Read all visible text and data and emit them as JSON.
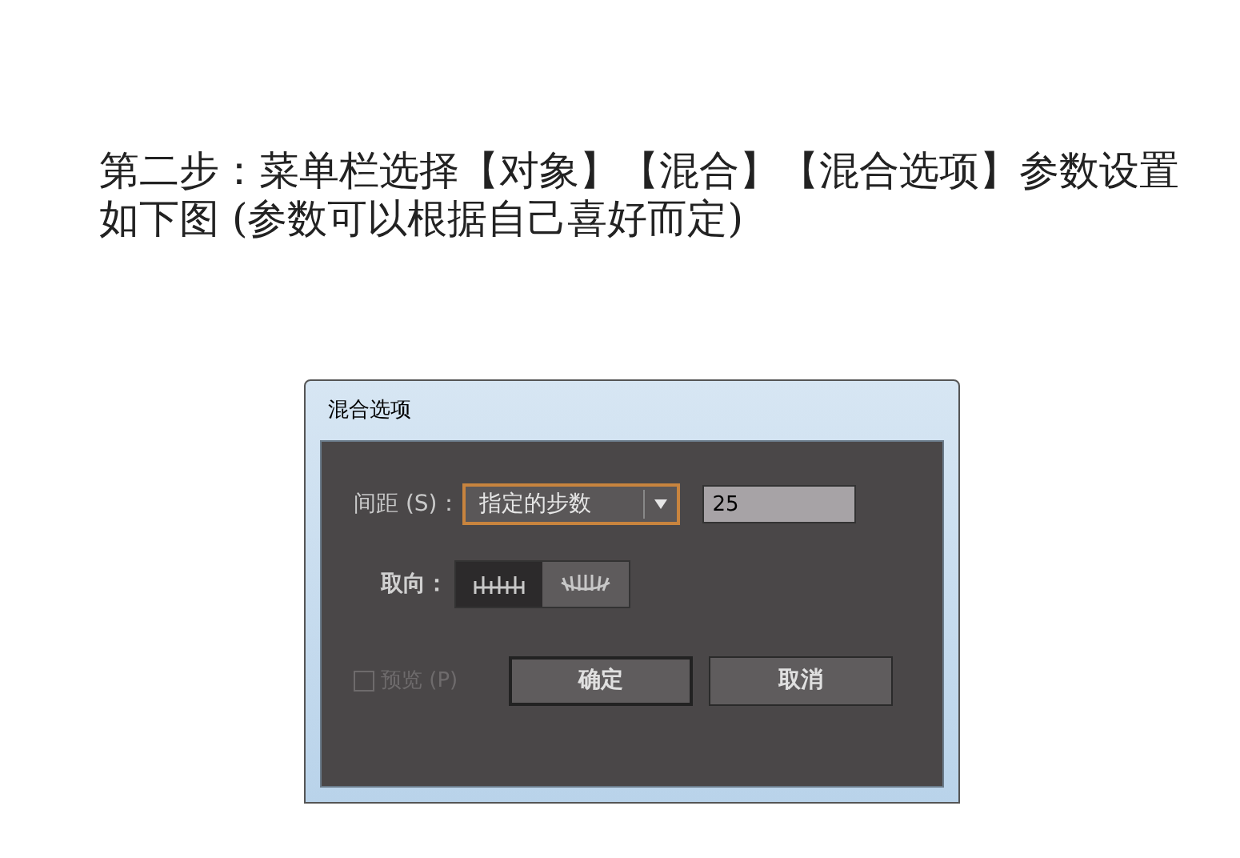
{
  "instruction": "第二步：菜单栏选择【对象】【混合】【混合选项】参数设置如下图 (参数可以根据自己喜好而定)",
  "dialog": {
    "title": "混合选项",
    "spacing": {
      "label": "间距 (S)：",
      "value": "指定的步数",
      "steps": "25"
    },
    "orientation": {
      "label": "取向：",
      "options": [
        {
          "kind": "page",
          "selected": true
        },
        {
          "kind": "path",
          "selected": false
        }
      ]
    },
    "preview": {
      "label": "预览 (P)",
      "checked": false,
      "disabled": true
    },
    "buttons": [
      "确定",
      "取消"
    ]
  }
}
